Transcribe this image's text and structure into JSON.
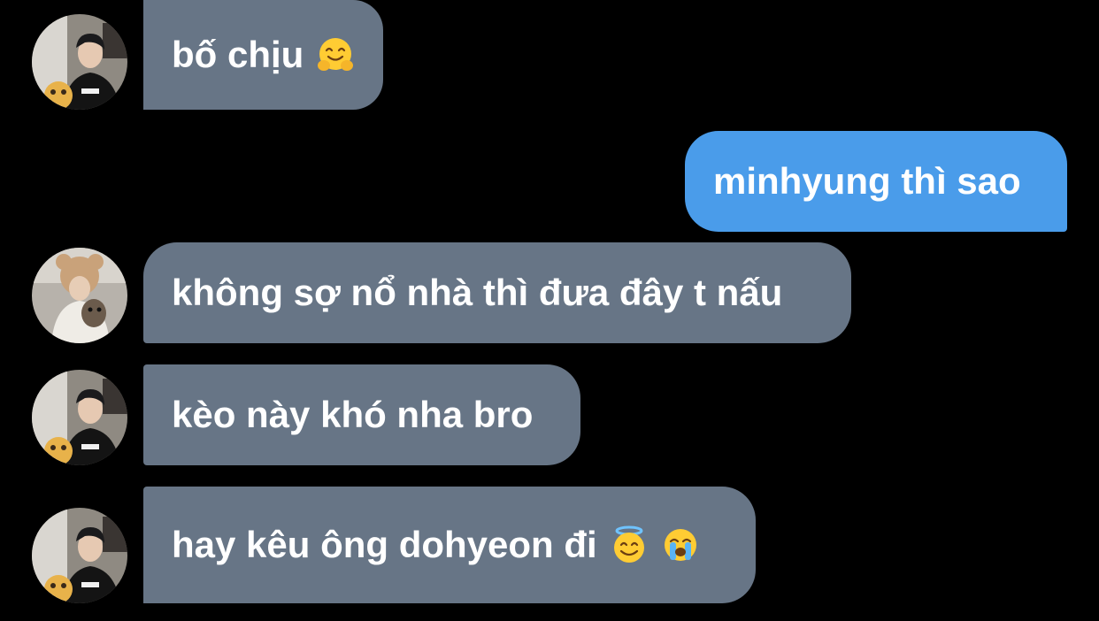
{
  "messages": [
    {
      "sender": "contact",
      "text": "bố chịu",
      "emojis": [
        "hugging-face-emoji"
      ]
    },
    {
      "sender": "me",
      "text": "minhyung thì sao",
      "emojis": []
    },
    {
      "sender": "contact",
      "text": "không sợ nổ nhà thì đưa đây t nấu",
      "emojis": []
    },
    {
      "sender": "contact",
      "text": "kèo này khó nha bro",
      "emojis": []
    },
    {
      "sender": "contact",
      "text": "hay kêu ông dohyeon đi",
      "emojis": [
        "smiling-face-with-halo-emoji",
        "loudly-crying-face-emoji"
      ]
    }
  ],
  "colors": {
    "background": "#000000",
    "incoming_bubble": "#677586",
    "outgoing_bubble": "#4a9cea",
    "text": "#ffffff"
  }
}
